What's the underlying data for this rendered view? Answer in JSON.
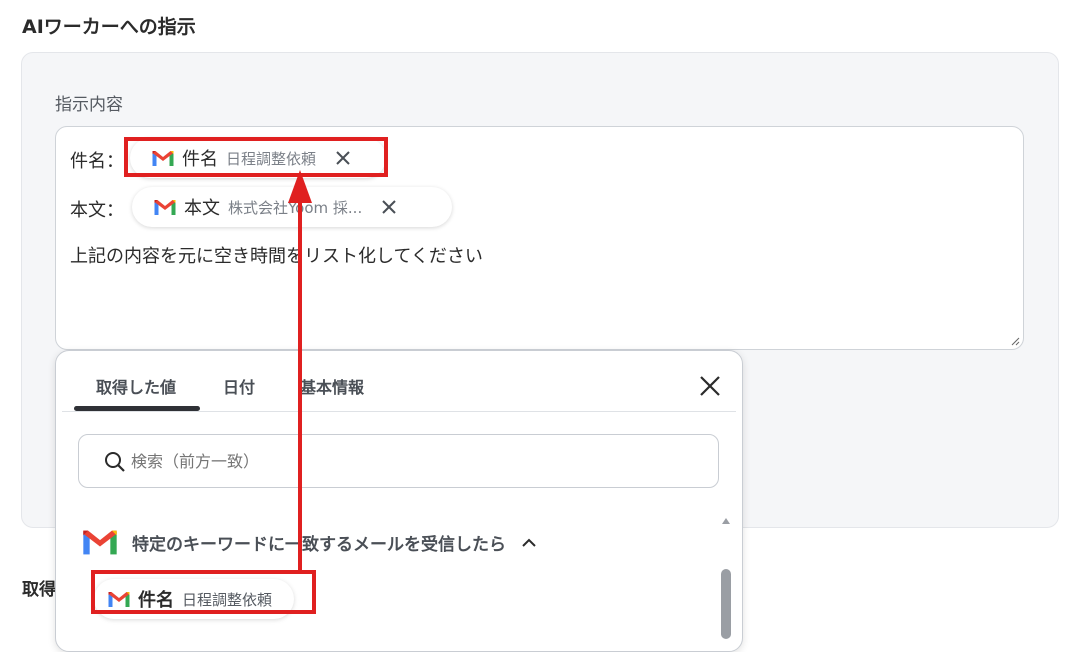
{
  "section_title": "AIワーカーへの指示",
  "field_label": "指示内容",
  "editor": {
    "subject_label": "件名：",
    "body_label": "本文：",
    "subject_chip": {
      "name": "件名",
      "value": "日程調整依頼"
    },
    "body_chip": {
      "name": "本文",
      "value": "株式会社Yoom 採..."
    },
    "instruction_text": "上記の内容を元に空き時間をリスト化してください"
  },
  "dropdown": {
    "tabs": [
      {
        "label": "取得した値",
        "active": true
      },
      {
        "label": "日付",
        "active": false
      },
      {
        "label": "基本情報",
        "active": false
      }
    ],
    "search_placeholder": "検索（前方一致）",
    "group_title": "特定のキーワードに一致するメールを受信したら",
    "items": [
      {
        "name": "件名",
        "value": "日程調整依頼"
      }
    ]
  },
  "below_title": "取得",
  "colors": {
    "highlight": "#e02020",
    "gmail_red": "#EA4335",
    "gmail_blue": "#4285F4",
    "gmail_green": "#34A853",
    "gmail_yellow": "#FBBC04"
  }
}
